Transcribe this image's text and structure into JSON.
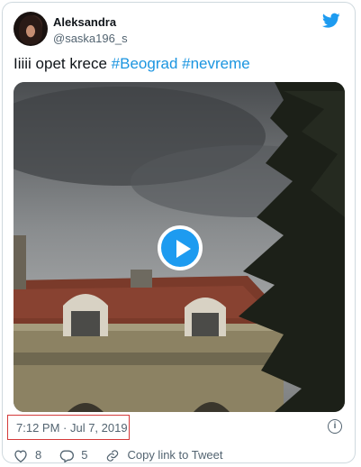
{
  "user": {
    "name": "Aleksandra",
    "handle": "@saska196_s"
  },
  "tweet": {
    "text": "Iiiii opet krece ",
    "hashtags": [
      "#Beograd",
      "#nevreme"
    ]
  },
  "media": {
    "type": "video",
    "icon": "play-icon"
  },
  "timestamp": "7:12 PM · Jul 7, 2019",
  "actions": {
    "likes": "8",
    "replies": "5",
    "copy_link_label": "Copy link to Tweet"
  },
  "colors": {
    "brand": "#1d9bf0",
    "hashtag": "#1b95e0",
    "highlight_box": "#d43a3a"
  }
}
